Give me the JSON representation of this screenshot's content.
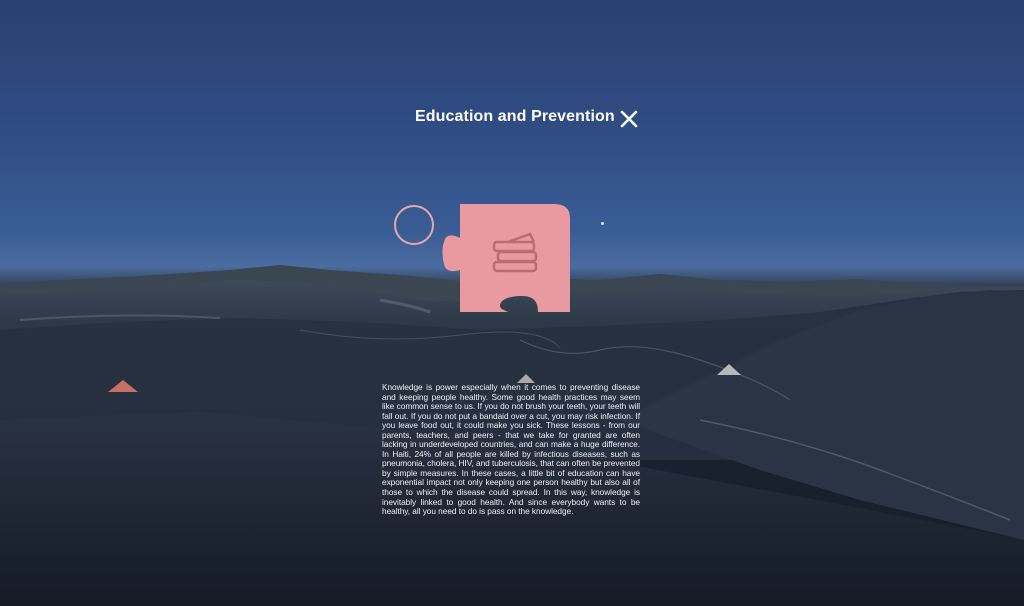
{
  "panel": {
    "title": "Education and Prevention",
    "close_icon": "close-icon",
    "puzzle_icon": "books-icon",
    "accent_color": "#e89aa0",
    "body": "Knowledge is power especially when it comes to preventing disease and keeping people healthy. Some good health practices may seem like common sense to us. If you do not brush your teeth, your teeth will fall out. If you do not put a bandaid over a cut, you may risk infection. If you leave food out, it could make you sick. These lessons - from our parents, teachers, and peers - that we take for granted are often lacking in underdeveloped countries, and can make a huge difference. In Haiti, 24% of all people are killed by infectious diseases, such as pneumonia, cholera, HIV, and tuberculosis, that can often be prevented by simple measures. In these cases, a little bit of education can have exponential impact not only keeping one person healthy but also all of those to which the disease could spread. In this way, knowledge is inevitably linked to good health. And since everybody wants to be healthy, all you need to do is pass on the knowledge."
  },
  "scene": {
    "sky_color": "#2f4d84",
    "ground_color": "#1a2230",
    "markers": [
      "marker-left",
      "marker-center",
      "marker-right"
    ]
  }
}
